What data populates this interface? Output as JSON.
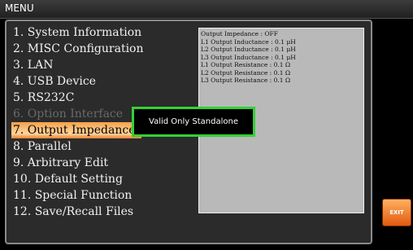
{
  "titlebar": {
    "title": "MENU"
  },
  "menu": {
    "items": [
      {
        "label": "1. System Information",
        "state": "normal"
      },
      {
        "label": "2. MISC Configuration",
        "state": "normal"
      },
      {
        "label": "3. LAN",
        "state": "normal"
      },
      {
        "label": "4. USB Device",
        "state": "normal"
      },
      {
        "label": "5. RS232C",
        "state": "normal"
      },
      {
        "label": "6. Option Interface",
        "state": "disabled"
      },
      {
        "label": "7. Output Impedance",
        "state": "selected"
      },
      {
        "label": "8. Parallel",
        "state": "normal"
      },
      {
        "label": "9. Arbitrary Edit",
        "state": "normal"
      },
      {
        "label": "10. Default Setting",
        "state": "normal"
      },
      {
        "label": "11. Special Function",
        "state": "normal"
      },
      {
        "label": "12. Save/Recall Files",
        "state": "normal"
      }
    ]
  },
  "panel": {
    "lines": [
      "Output Impedance : OFF",
      "L1 Output Inductance : 0.1 μH",
      "L2 Output Inductance : 0.1 μH",
      "L3 Output Inductance : 0.1 μH",
      "L1 Output Resistance : 0.1 Ω",
      "L2 Output Resistance : 0.1 Ω",
      "L3 Output Resistance : 0.1 Ω"
    ]
  },
  "popup": {
    "message": "Valid Only Standalone"
  },
  "softkeys": {
    "exit_label": "EXIT"
  },
  "colors": {
    "selected": "#f5a04a",
    "popup_border": "#35d035",
    "exit": "#e25a10"
  }
}
